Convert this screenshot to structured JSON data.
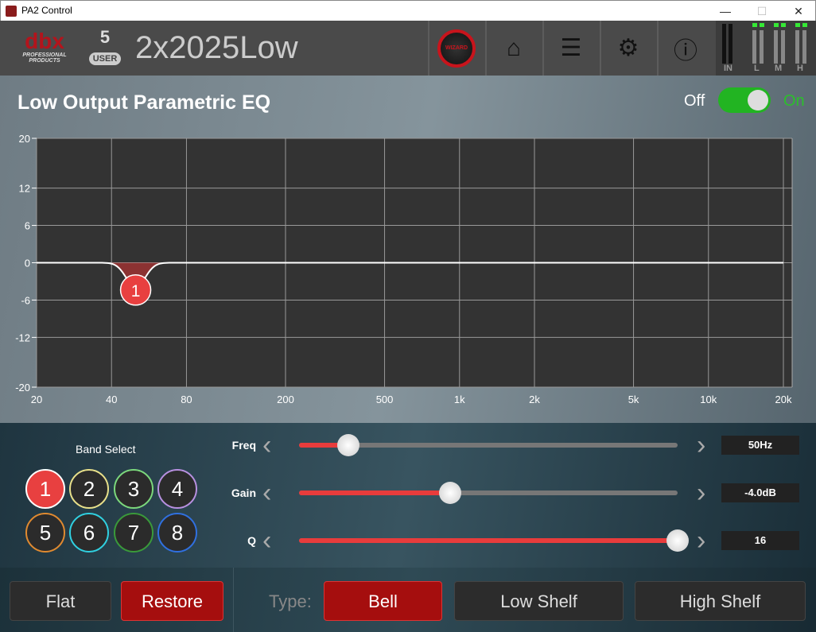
{
  "window": {
    "title": "PA2 Control",
    "minimize": "—",
    "maximize": "☐",
    "close": "✕"
  },
  "header": {
    "logo_text": "dbx",
    "logo_sub": "PROFESSIONAL PRODUCTS",
    "preset_number": "5",
    "preset_badge": "USER",
    "preset_name": "2x2025Low",
    "wizard_label": "WIZARD",
    "home_icon": "⌂",
    "list_icon": "☰",
    "settings_icon": "⚙",
    "info_icon": "ⓘ",
    "meters": [
      "IN",
      "L",
      "M",
      "H"
    ]
  },
  "eq": {
    "title": "Low Output Parametric EQ",
    "off_label": "Off",
    "on_label": "On",
    "enabled": true
  },
  "chart_data": {
    "type": "line",
    "x_scale": "log",
    "xlim": [
      20,
      20000
    ],
    "ylim": [
      -20,
      20
    ],
    "x_ticks": [
      "20",
      "40",
      "80",
      "200",
      "500",
      "1k",
      "2k",
      "5k",
      "10k",
      "20k"
    ],
    "x_tick_values": [
      20,
      40,
      80,
      200,
      500,
      1000,
      2000,
      5000,
      10000,
      20000
    ],
    "y_ticks": [
      "20",
      "12",
      "6",
      "0",
      "-6",
      "-12",
      "-20"
    ],
    "y_tick_values": [
      20,
      12,
      6,
      0,
      -6,
      -12,
      -20
    ],
    "grid": true,
    "bands": [
      {
        "label": "1",
        "freq": 50,
        "gain": -4.0,
        "q": 16,
        "type": "Bell",
        "color": "#e84040"
      }
    ]
  },
  "controls": {
    "band_select_label": "Band Select",
    "bands": [
      {
        "label": "1",
        "color": "#e84040",
        "selected": true
      },
      {
        "label": "2",
        "color": "#e8e08a"
      },
      {
        "label": "3",
        "color": "#7cd87c"
      },
      {
        "label": "4",
        "color": "#b890e0"
      },
      {
        "label": "5",
        "color": "#e08a30"
      },
      {
        "label": "6",
        "color": "#30d0e0"
      },
      {
        "label": "7",
        "color": "#3a9a3a"
      },
      {
        "label": "8",
        "color": "#3070e0"
      }
    ],
    "sliders": [
      {
        "label": "Freq",
        "value": "50Hz",
        "fraction": 0.13
      },
      {
        "label": "Gain",
        "value": "-4.0dB",
        "fraction": 0.4
      },
      {
        "label": "Q",
        "value": "16",
        "fraction": 1.0
      }
    ]
  },
  "footer": {
    "flat": "Flat",
    "restore": "Restore",
    "type_label": "Type:",
    "types": [
      "Bell",
      "Low Shelf",
      "High Shelf"
    ],
    "selected_type": "Bell"
  }
}
